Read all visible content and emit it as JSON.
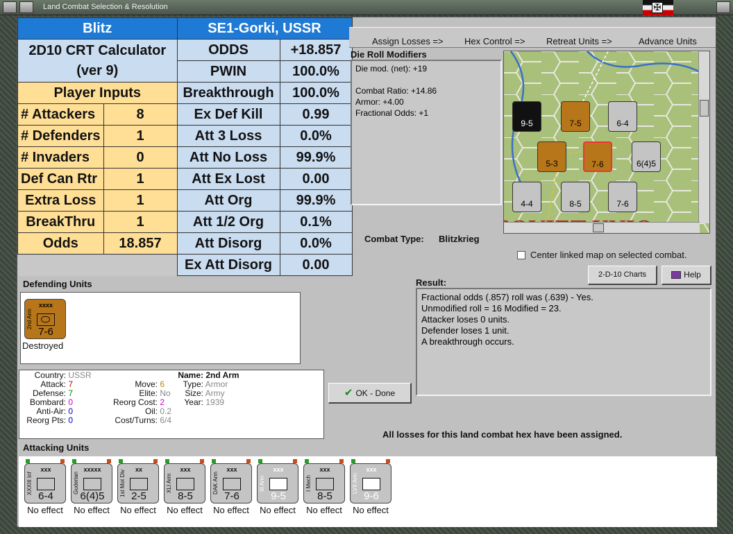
{
  "window": {
    "title": "Land Combat Selection & Resolution"
  },
  "calc": {
    "blitz": "Blitz",
    "location": "SE1-Gorki, USSR",
    "calc_title": "2D10 CRT Calculator",
    "calc_ver": "(ver 9)",
    "player_inputs": "Player Inputs",
    "inputs": [
      {
        "label": "# Attackers",
        "value": "8"
      },
      {
        "label": "# Defenders",
        "value": "1"
      },
      {
        "label": "# Invaders",
        "value": "0"
      },
      {
        "label": "Def Can Rtr",
        "value": "1"
      },
      {
        "label": "Extra Loss",
        "value": "1"
      },
      {
        "label": "BreakThru",
        "value": "1"
      },
      {
        "label": "Odds",
        "value": "18.857"
      }
    ],
    "results": [
      {
        "label": "ODDS",
        "value": "+18.857"
      },
      {
        "label": "PWIN",
        "value": "100.0%"
      },
      {
        "label": "Breakthrough",
        "value": "100.0%"
      },
      {
        "label": "Ex Def Kill",
        "value": "0.99"
      },
      {
        "label": "Att 3 Loss",
        "value": "0.0%"
      },
      {
        "label": "Att No Loss",
        "value": "99.9%"
      },
      {
        "label": "Att Ex Lost",
        "value": "0.00"
      },
      {
        "label": "Att Org",
        "value": "99.9%"
      },
      {
        "label": "Att 1/2 Org",
        "value": "0.1%"
      },
      {
        "label": "Att Disorg",
        "value": "0.0%"
      },
      {
        "label": "Ex Att Disorg",
        "value": "0.00"
      }
    ]
  },
  "steps": {
    "assign": "Assign Losses =>",
    "hex": "Hex Control =>",
    "retreat": "Retreat Units =>",
    "advance": "Advance Units"
  },
  "die_mods": {
    "title": "Die Roll Modifiers",
    "lines": [
      "Die mod. (net): +19",
      "",
      "Combat Ratio: +14.86",
      "Armor: +4.00",
      "Fractional Odds: +1"
    ]
  },
  "combat_type": {
    "label": "Combat Type:",
    "value": "Blitzkrieg"
  },
  "center_map": "Center linked map on selected combat.",
  "buttons": {
    "charts": "2-D-10 Charts",
    "help": "Help",
    "ok": "OK - Done"
  },
  "result": {
    "title": "Result:",
    "lines": [
      "Fractional odds (.857) roll was (.639)  - Yes.",
      "Unmodified roll = 16  Modified = 23.",
      "Attacker loses 0 units.",
      "Defender loses 1 unit.",
      "A breakthrough occurs."
    ],
    "roll_bold": "16"
  },
  "defending": {
    "title": "Defending Units",
    "unit": {
      "size": "xxxx",
      "name": "2nd Arm",
      "value": "7-6",
      "status": "Destroyed"
    }
  },
  "info": {
    "country_k": "Country:",
    "country_v": "USSR",
    "attack_k": "Attack:",
    "attack_v": "7",
    "defense_k": "Defense:",
    "defense_v": "7",
    "bombard_k": "Bombard:",
    "bombard_v": "0",
    "antiair_k": "Anti-Air:",
    "antiair_v": "0",
    "reorgpts_k": "Reorg Pts:",
    "reorgpts_v": "0",
    "move_k": "Move:",
    "move_v": "6",
    "elite_k": "Elite:",
    "elite_v": "No",
    "reorgcost_k": "Reorg Cost:",
    "reorgcost_v": "2",
    "oil_k": "Oil:",
    "oil_v": "0.2",
    "costturns_k": "Cost/Turns:",
    "costturns_v": "6/4",
    "name_k": "Name:",
    "name_v": "2nd Arm",
    "type_k": "Type:",
    "type_v": "Armor",
    "size_k": "Size:",
    "size_v": "Army",
    "year_k": "Year:",
    "year_v": "1939"
  },
  "losses_msg": "All losses for this land combat hex have been assigned.",
  "attacking": {
    "title": "Attacking Units",
    "units": [
      {
        "name": "XXXIII Inf",
        "size": "xxx",
        "value": "6-4",
        "status": "No effect",
        "white": false
      },
      {
        "name": "Guderian",
        "size": "xxxxx",
        "value": "6(4)5",
        "status": "No effect",
        "white": false
      },
      {
        "name": "1st Mot Div",
        "size": "xx",
        "value": "2-5",
        "status": "No effect",
        "white": false
      },
      {
        "name": "XLI Arm",
        "size": "xxx",
        "value": "8-5",
        "status": "No effect",
        "white": false
      },
      {
        "name": "DAK Arm",
        "size": "xxx",
        "value": "7-6",
        "status": "No effect",
        "white": false
      },
      {
        "name": "III Arm",
        "size": "xxx",
        "value": "9-5",
        "status": "No effect",
        "white": true
      },
      {
        "name": "I Mech",
        "size": "xxx",
        "value": "8-5",
        "status": "No effect",
        "white": false
      },
      {
        "name": "LVII Arm",
        "size": "xxx",
        "value": "9-6",
        "status": "No effect",
        "white": true
      }
    ]
  },
  "map": {
    "units": [
      {
        "value": "9-5",
        "dark": true
      },
      {
        "value": "7-5",
        "dark": false,
        "brown": true
      },
      {
        "value": "6-4",
        "dark": false
      },
      {
        "value": "5-3",
        "dark": false,
        "brown": true
      },
      {
        "value": "7-6",
        "dark": false,
        "brown": true
      },
      {
        "value": "6(4)5",
        "dark": false
      },
      {
        "value": "4-4",
        "dark": false
      },
      {
        "value": "8-5",
        "dark": false
      },
      {
        "value": "7-6",
        "dark": false
      }
    ],
    "banner": "SOVIET UNIO"
  },
  "colors": {
    "blue": "#1f7ad6",
    "yellow": "#ffdf96",
    "light_blue": "#c9dcf0",
    "brown": "#b8761a"
  }
}
